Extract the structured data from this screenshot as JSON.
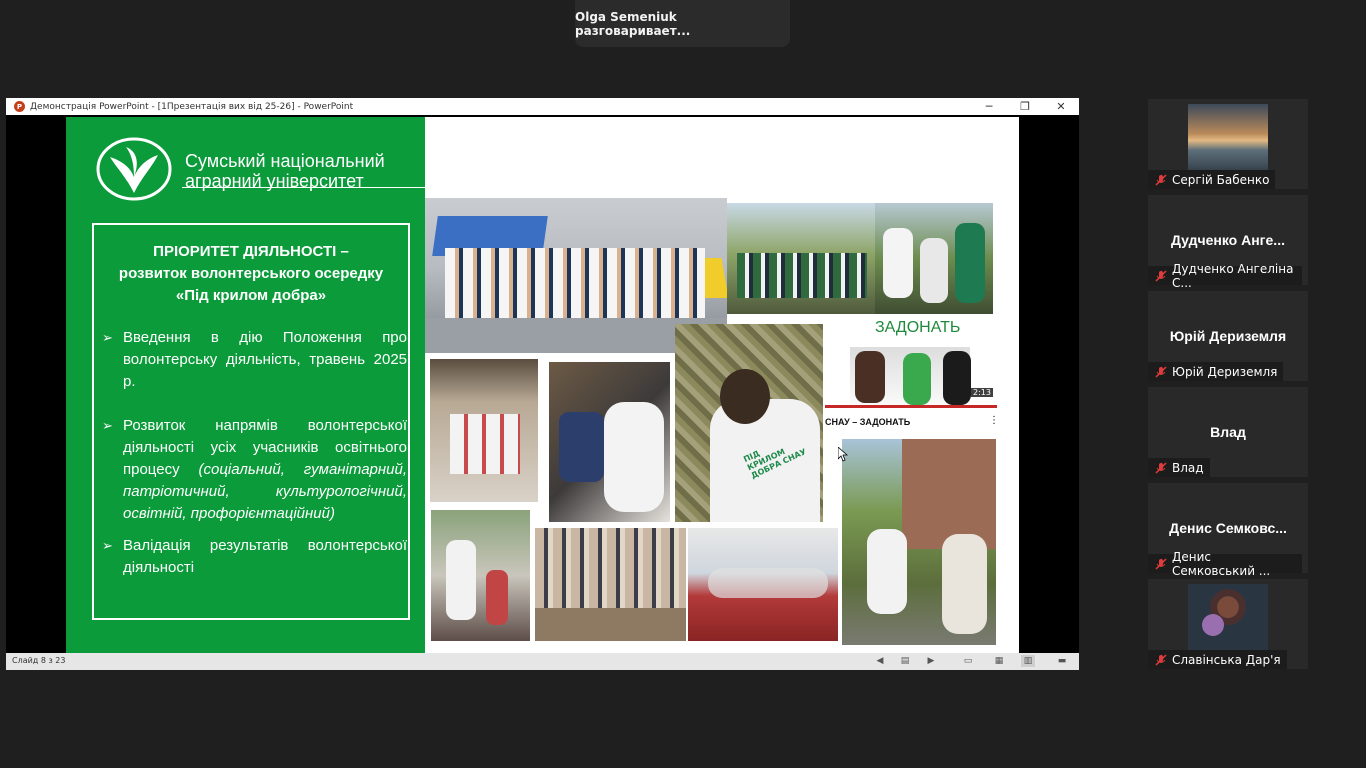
{
  "toast": {
    "text": "Olga Semeniuk разговаривает..."
  },
  "window": {
    "title": "Демонстрація PowerPoint - [1Презентація вих від 25-26] - PowerPoint",
    "app_icon_letter": "P",
    "minimize_icon": "minimize-icon",
    "restore_icon": "restore-icon",
    "close_icon": "close-icon"
  },
  "slide": {
    "university_line1": "Сумський національний",
    "university_line2": "аграрний університет",
    "box_title_line1": "ПРІОРИТЕТ ДІЯЛЬНОСТІ –",
    "box_title_line2": "розвиток волонтерського осередку",
    "box_title_line3": "«Під крилом добра»",
    "bullets": [
      {
        "text": "Введення в дію Положення про волонтерську діяльність, травень 2025 р."
      },
      {
        "text": "Розвиток напрямів волонтерської діяльності усіх учасників освітнього процесу",
        "italic": "(соціальний, гуманітарний, патріотичний, культурологічний, освітній, профорієнтаційний)"
      },
      {
        "text": "Валідація результатів волонтерської діяльності"
      }
    ],
    "bullet_glyph": "➢",
    "video_title_banner": "ЗАДОНАТЬ",
    "video_duration": "2:13",
    "video_caption": "СНАУ – ЗАДОНАТЬ",
    "shirt_text": "ПІД КРИЛОМ ДОБРА СНАУ"
  },
  "statusbar": {
    "slide_counter": "Слайд 8 з 23"
  },
  "participants": [
    {
      "name": "Сергій Бабенко",
      "label": "Сергій Бабенко",
      "has_photo": true
    },
    {
      "name": "Дудченко  Анге...",
      "label": "Дудченко Ангеліна С...",
      "has_photo": false
    },
    {
      "name": "Юрій Дериземля",
      "label": "Юрій Дериземля",
      "has_photo": false
    },
    {
      "name": "Влад",
      "label": "Влад",
      "has_photo": false
    },
    {
      "name": "Денис  Семковс...",
      "label": "Денис Семковський ...",
      "has_photo": false
    },
    {
      "name": "Славінська Дар'я",
      "label": "Славінська Дар'я",
      "has_photo": true
    }
  ],
  "colors": {
    "slide_green": "#0b9b3b",
    "muted_mic": "#e03c3c",
    "window_bg": "#1f1f1f"
  }
}
